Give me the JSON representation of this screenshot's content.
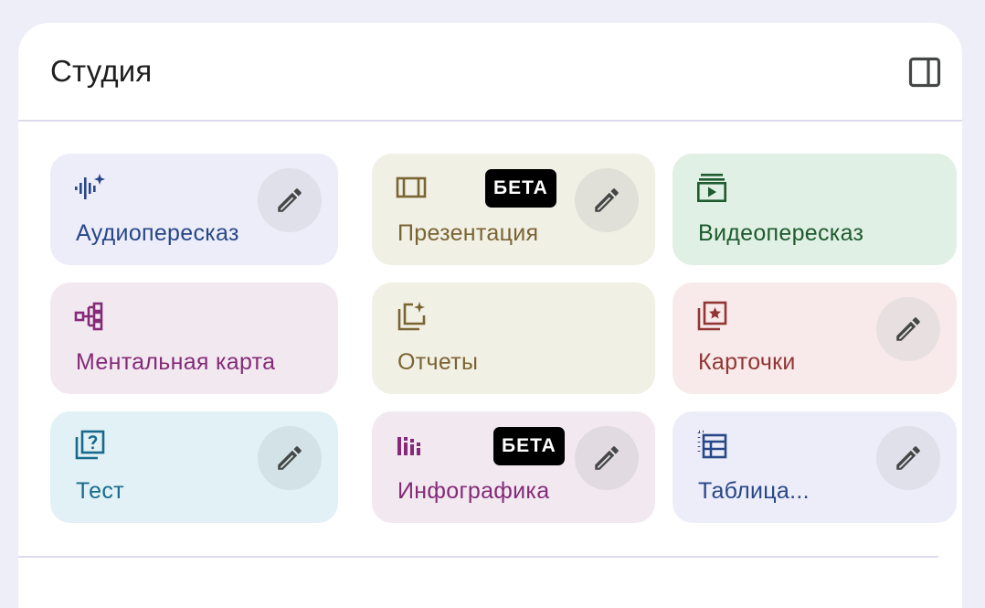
{
  "panel": {
    "title": "Студия",
    "toggle_icon": "side-panel-icon"
  },
  "beta_label": "БЕТА",
  "tiles": [
    {
      "label": "Аудиопересказ",
      "icon": "audio-sparkle-icon",
      "bg": "#ededf9",
      "fg": "#274787",
      "editable": true,
      "beta": false
    },
    {
      "label": "Презентация",
      "icon": "slides-icon",
      "bg": "#f1f0e5",
      "fg": "#7a6432",
      "editable": true,
      "beta": true
    },
    {
      "label": "Видеопересказ",
      "icon": "video-stack-icon",
      "bg": "#e1f0e5",
      "fg": "#1e5b2d",
      "editable": false,
      "beta": false
    },
    {
      "label": "Ментальная карта",
      "icon": "mind-map-icon",
      "bg": "#f2e9f0",
      "fg": "#842a78",
      "editable": false,
      "beta": false
    },
    {
      "label": "Отчеты",
      "icon": "report-sparkle-icon",
      "bg": "#f1f0e5",
      "fg": "#7a6432",
      "editable": false,
      "beta": false
    },
    {
      "label": "Карточки",
      "icon": "flashcards-icon",
      "bg": "#f8eaea",
      "fg": "#923534",
      "editable": true,
      "beta": false
    },
    {
      "label": "Тест",
      "icon": "quiz-icon",
      "bg": "#e1f1f5",
      "fg": "#176a8c",
      "editable": true,
      "beta": false
    },
    {
      "label": "Инфографика",
      "icon": "infographic-icon",
      "bg": "#f2e9f0",
      "fg": "#842a78",
      "editable": true,
      "beta": true
    },
    {
      "label": "Таблица...",
      "icon": "table-icon",
      "bg": "#ededf9",
      "fg": "#274787",
      "editable": true,
      "beta": false
    }
  ]
}
